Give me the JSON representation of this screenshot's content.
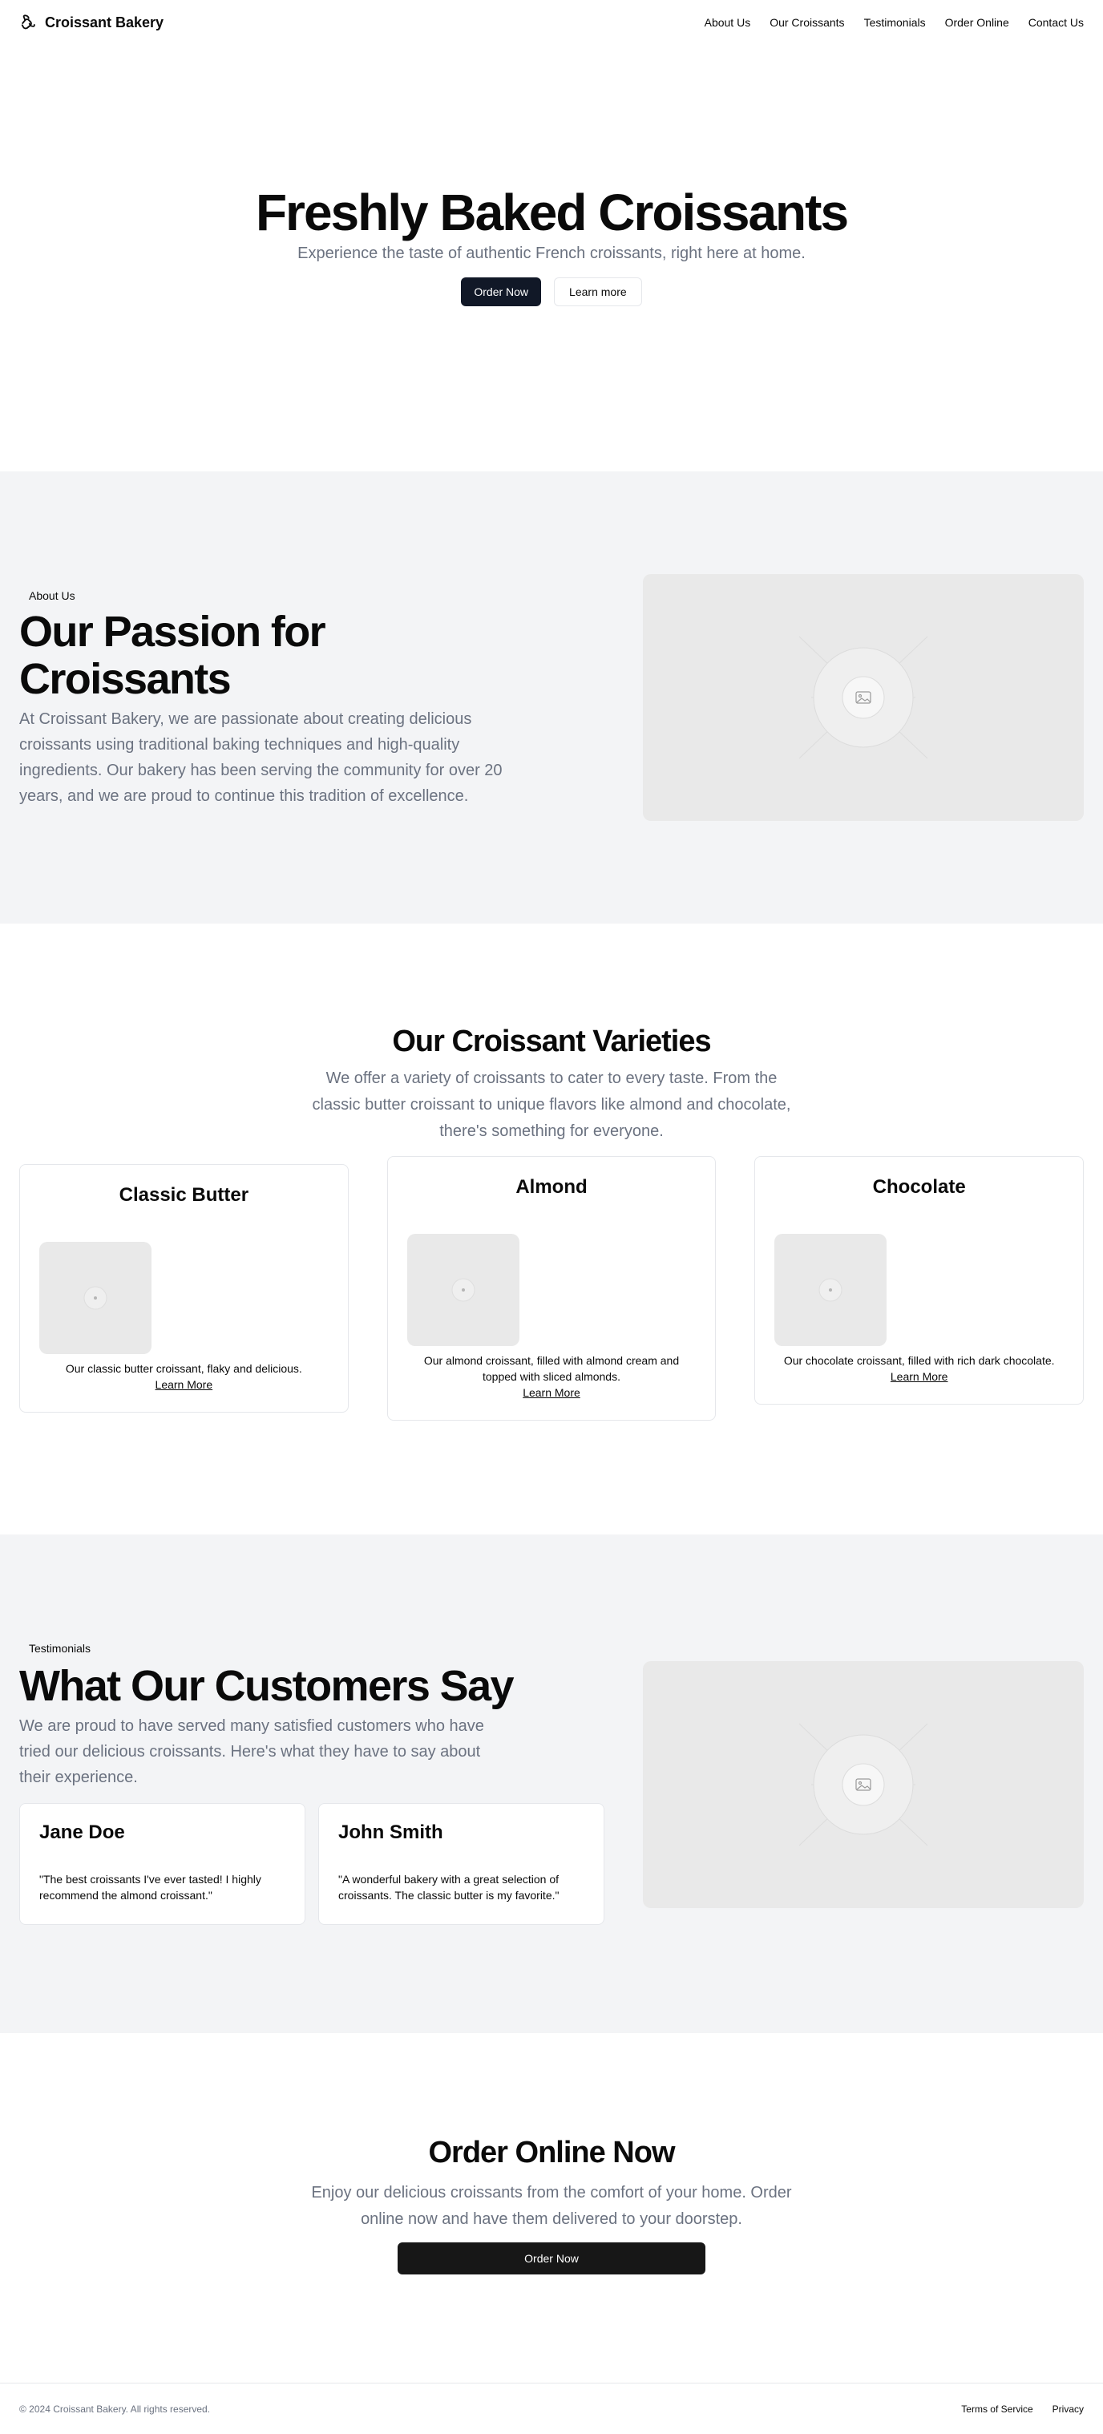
{
  "header": {
    "brand": "Croissant Bakery",
    "brand_icon": "croissant-icon",
    "nav": [
      "About Us",
      "Our Croissants",
      "Testimonials",
      "Order Online",
      "Contact Us"
    ]
  },
  "hero": {
    "title": "Freshly Baked Croissants",
    "subtitle": "Experience the taste of authentic French croissants, right here at home.",
    "primary_button": "Order Now",
    "secondary_button": "Learn more"
  },
  "about": {
    "badge": "About Us",
    "title": "Our Passion for Croissants",
    "body": "At Croissant Bakery, we are passionate about creating delicious croissants using traditional baking techniques and high-quality ingredients. Our bakery has been serving the community for over 20 years, and we are proud to continue this tradition of excellence.",
    "image_icon": "image-placeholder-icon"
  },
  "varieties": {
    "title": "Our Croissant Varieties",
    "subtitle": "We offer a variety of croissants to cater to every taste. From the classic butter croissant to unique flavors like almond and chocolate, there's something for everyone.",
    "items": [
      {
        "name": "Classic Butter",
        "description": "Our classic butter croissant, flaky and delicious.",
        "link": "Learn More"
      },
      {
        "name": "Almond",
        "description": "Our almond croissant, filled with almond cream and topped with sliced almonds.",
        "link": "Learn More"
      },
      {
        "name": "Chocolate",
        "description": "Our chocolate croissant, filled with rich dark chocolate.",
        "link": "Learn More"
      }
    ]
  },
  "testimonials": {
    "badge": "Testimonials",
    "title": "What Our Customers Say",
    "subtitle": "We are proud to have served many satisfied customers who have tried our delicious croissants. Here's what they have to say about their experience.",
    "items": [
      {
        "name": "Jane Doe",
        "quote": "\"The best croissants I've ever tasted! I highly recommend the almond croissant.\""
      },
      {
        "name": "John Smith",
        "quote": "\"A wonderful bakery with a great selection of croissants. The classic butter is my favorite.\""
      }
    ]
  },
  "order": {
    "title": "Order Online Now",
    "subtitle": "Enjoy our delicious croissants from the comfort of your home. Order online now and have them delivered to your doorstep.",
    "button": "Order Now"
  },
  "footer": {
    "copyright": "© 2024 Croissant Bakery. All rights reserved.",
    "links": [
      "Terms of Service",
      "Privacy"
    ]
  },
  "colors": {
    "primary_button": "#111827",
    "muted_text": "#6b7280",
    "section_bg": "#f3f4f6",
    "placeholder_bg": "#e9e9e9"
  }
}
